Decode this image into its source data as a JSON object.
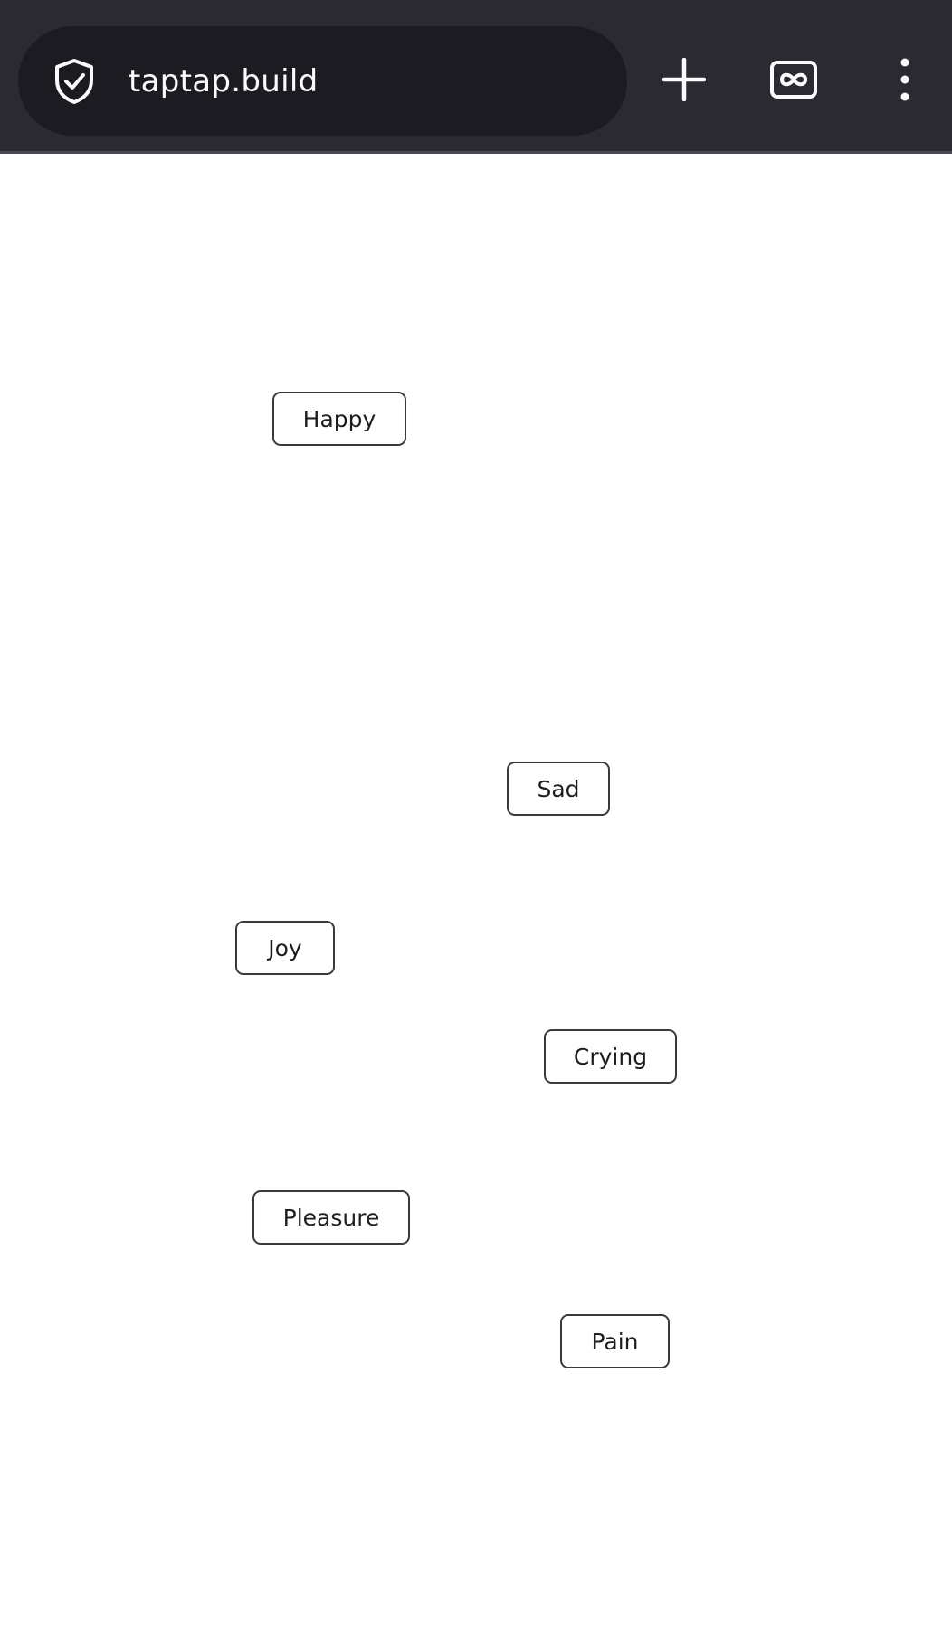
{
  "browser": {
    "url": "taptap.build",
    "icons": {
      "security": "shield-check-icon",
      "new_tab": "plus-icon",
      "tabs": "private-tabs-icon",
      "menu": "kebab-menu-icon"
    },
    "colors": {
      "toolbar_bg": "#2b2a33",
      "url_bar_bg": "#1c1b22",
      "text": "#fbfbfe"
    }
  },
  "canvas": {
    "words": [
      {
        "label": "Happy"
      },
      {
        "label": "Sad"
      },
      {
        "label": "Joy"
      },
      {
        "label": "Crying"
      },
      {
        "label": "Pleasure"
      },
      {
        "label": "Pain"
      }
    ]
  }
}
